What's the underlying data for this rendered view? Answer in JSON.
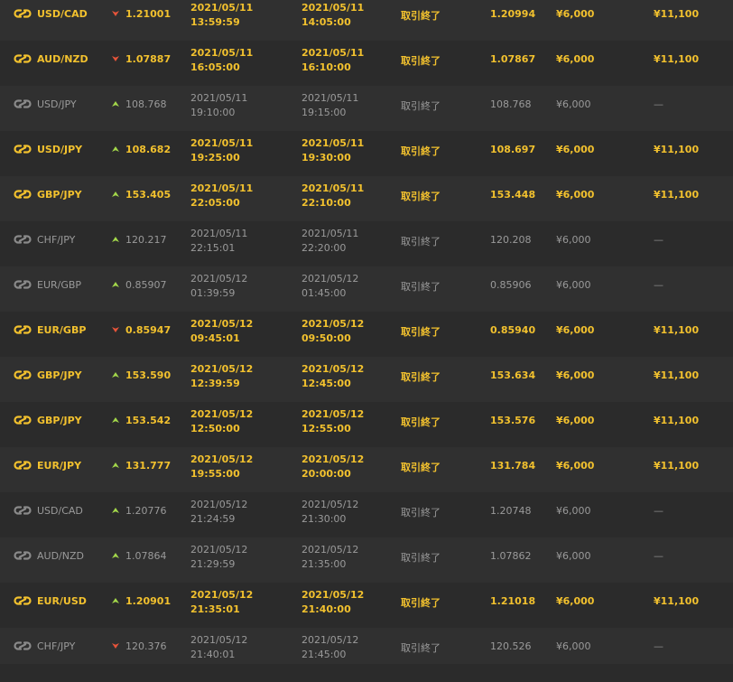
{
  "colors": {
    "background": "#2b2b2b",
    "row_alt": "#303030",
    "win_text": "#f2c12e",
    "loss_text": "#9a9a9a",
    "up_arrow": "#a3d84a",
    "down_arrow": "#e8543a"
  },
  "icons": {
    "asset": "link-chain-icon",
    "up": "arrow-up-icon",
    "down": "arrow-down-icon"
  },
  "trades": [
    {
      "asset": "USD/CAD",
      "direction": "down",
      "strike": "1.21001",
      "entry_date": "2021/05/11",
      "entry_time": "13:59:59",
      "expiry_date": "2021/05/11",
      "expiry_time": "14:05:00",
      "status": "取引終了",
      "close": "1.20994",
      "amount": "¥6,000",
      "payout": "¥11,100",
      "result": "win"
    },
    {
      "asset": "AUD/NZD",
      "direction": "down",
      "strike": "1.07887",
      "entry_date": "2021/05/11",
      "entry_time": "16:05:00",
      "expiry_date": "2021/05/11",
      "expiry_time": "16:10:00",
      "status": "取引終了",
      "close": "1.07867",
      "amount": "¥6,000",
      "payout": "¥11,100",
      "result": "win"
    },
    {
      "asset": "USD/JPY",
      "direction": "up",
      "strike": "108.768",
      "entry_date": "2021/05/11",
      "entry_time": "19:10:00",
      "expiry_date": "2021/05/11",
      "expiry_time": "19:15:00",
      "status": "取引終了",
      "close": "108.768",
      "amount": "¥6,000",
      "payout": "—",
      "result": "loss"
    },
    {
      "asset": "USD/JPY",
      "direction": "up",
      "strike": "108.682",
      "entry_date": "2021/05/11",
      "entry_time": "19:25:00",
      "expiry_date": "2021/05/11",
      "expiry_time": "19:30:00",
      "status": "取引終了",
      "close": "108.697",
      "amount": "¥6,000",
      "payout": "¥11,100",
      "result": "win"
    },
    {
      "asset": "GBP/JPY",
      "direction": "up",
      "strike": "153.405",
      "entry_date": "2021/05/11",
      "entry_time": "22:05:00",
      "expiry_date": "2021/05/11",
      "expiry_time": "22:10:00",
      "status": "取引終了",
      "close": "153.448",
      "amount": "¥6,000",
      "payout": "¥11,100",
      "result": "win"
    },
    {
      "asset": "CHF/JPY",
      "direction": "up",
      "strike": "120.217",
      "entry_date": "2021/05/11",
      "entry_time": "22:15:01",
      "expiry_date": "2021/05/11",
      "expiry_time": "22:20:00",
      "status": "取引終了",
      "close": "120.208",
      "amount": "¥6,000",
      "payout": "—",
      "result": "loss"
    },
    {
      "asset": "EUR/GBP",
      "direction": "up",
      "strike": "0.85907",
      "entry_date": "2021/05/12",
      "entry_time": "01:39:59",
      "expiry_date": "2021/05/12",
      "expiry_time": "01:45:00",
      "status": "取引終了",
      "close": "0.85906",
      "amount": "¥6,000",
      "payout": "—",
      "result": "loss"
    },
    {
      "asset": "EUR/GBP",
      "direction": "down",
      "strike": "0.85947",
      "entry_date": "2021/05/12",
      "entry_time": "09:45:01",
      "expiry_date": "2021/05/12",
      "expiry_time": "09:50:00",
      "status": "取引終了",
      "close": "0.85940",
      "amount": "¥6,000",
      "payout": "¥11,100",
      "result": "win"
    },
    {
      "asset": "GBP/JPY",
      "direction": "up",
      "strike": "153.590",
      "entry_date": "2021/05/12",
      "entry_time": "12:39:59",
      "expiry_date": "2021/05/12",
      "expiry_time": "12:45:00",
      "status": "取引終了",
      "close": "153.634",
      "amount": "¥6,000",
      "payout": "¥11,100",
      "result": "win"
    },
    {
      "asset": "GBP/JPY",
      "direction": "up",
      "strike": "153.542",
      "entry_date": "2021/05/12",
      "entry_time": "12:50:00",
      "expiry_date": "2021/05/12",
      "expiry_time": "12:55:00",
      "status": "取引終了",
      "close": "153.576",
      "amount": "¥6,000",
      "payout": "¥11,100",
      "result": "win"
    },
    {
      "asset": "EUR/JPY",
      "direction": "up",
      "strike": "131.777",
      "entry_date": "2021/05/12",
      "entry_time": "19:55:00",
      "expiry_date": "2021/05/12",
      "expiry_time": "20:00:00",
      "status": "取引終了",
      "close": "131.784",
      "amount": "¥6,000",
      "payout": "¥11,100",
      "result": "win"
    },
    {
      "asset": "USD/CAD",
      "direction": "up",
      "strike": "1.20776",
      "entry_date": "2021/05/12",
      "entry_time": "21:24:59",
      "expiry_date": "2021/05/12",
      "expiry_time": "21:30:00",
      "status": "取引終了",
      "close": "1.20748",
      "amount": "¥6,000",
      "payout": "—",
      "result": "loss"
    },
    {
      "asset": "AUD/NZD",
      "direction": "up",
      "strike": "1.07864",
      "entry_date": "2021/05/12",
      "entry_time": "21:29:59",
      "expiry_date": "2021/05/12",
      "expiry_time": "21:35:00",
      "status": "取引終了",
      "close": "1.07862",
      "amount": "¥6,000",
      "payout": "—",
      "result": "loss"
    },
    {
      "asset": "EUR/USD",
      "direction": "up",
      "strike": "1.20901",
      "entry_date": "2021/05/12",
      "entry_time": "21:35:01",
      "expiry_date": "2021/05/12",
      "expiry_time": "21:40:00",
      "status": "取引終了",
      "close": "1.21018",
      "amount": "¥6,000",
      "payout": "¥11,100",
      "result": "win"
    },
    {
      "asset": "CHF/JPY",
      "direction": "down",
      "strike": "120.376",
      "entry_date": "2021/05/12",
      "entry_time": "21:40:01",
      "expiry_date": "2021/05/12",
      "expiry_time": "21:45:00",
      "status": "取引終了",
      "close": "120.526",
      "amount": "¥6,000",
      "payout": "—",
      "result": "loss"
    }
  ]
}
